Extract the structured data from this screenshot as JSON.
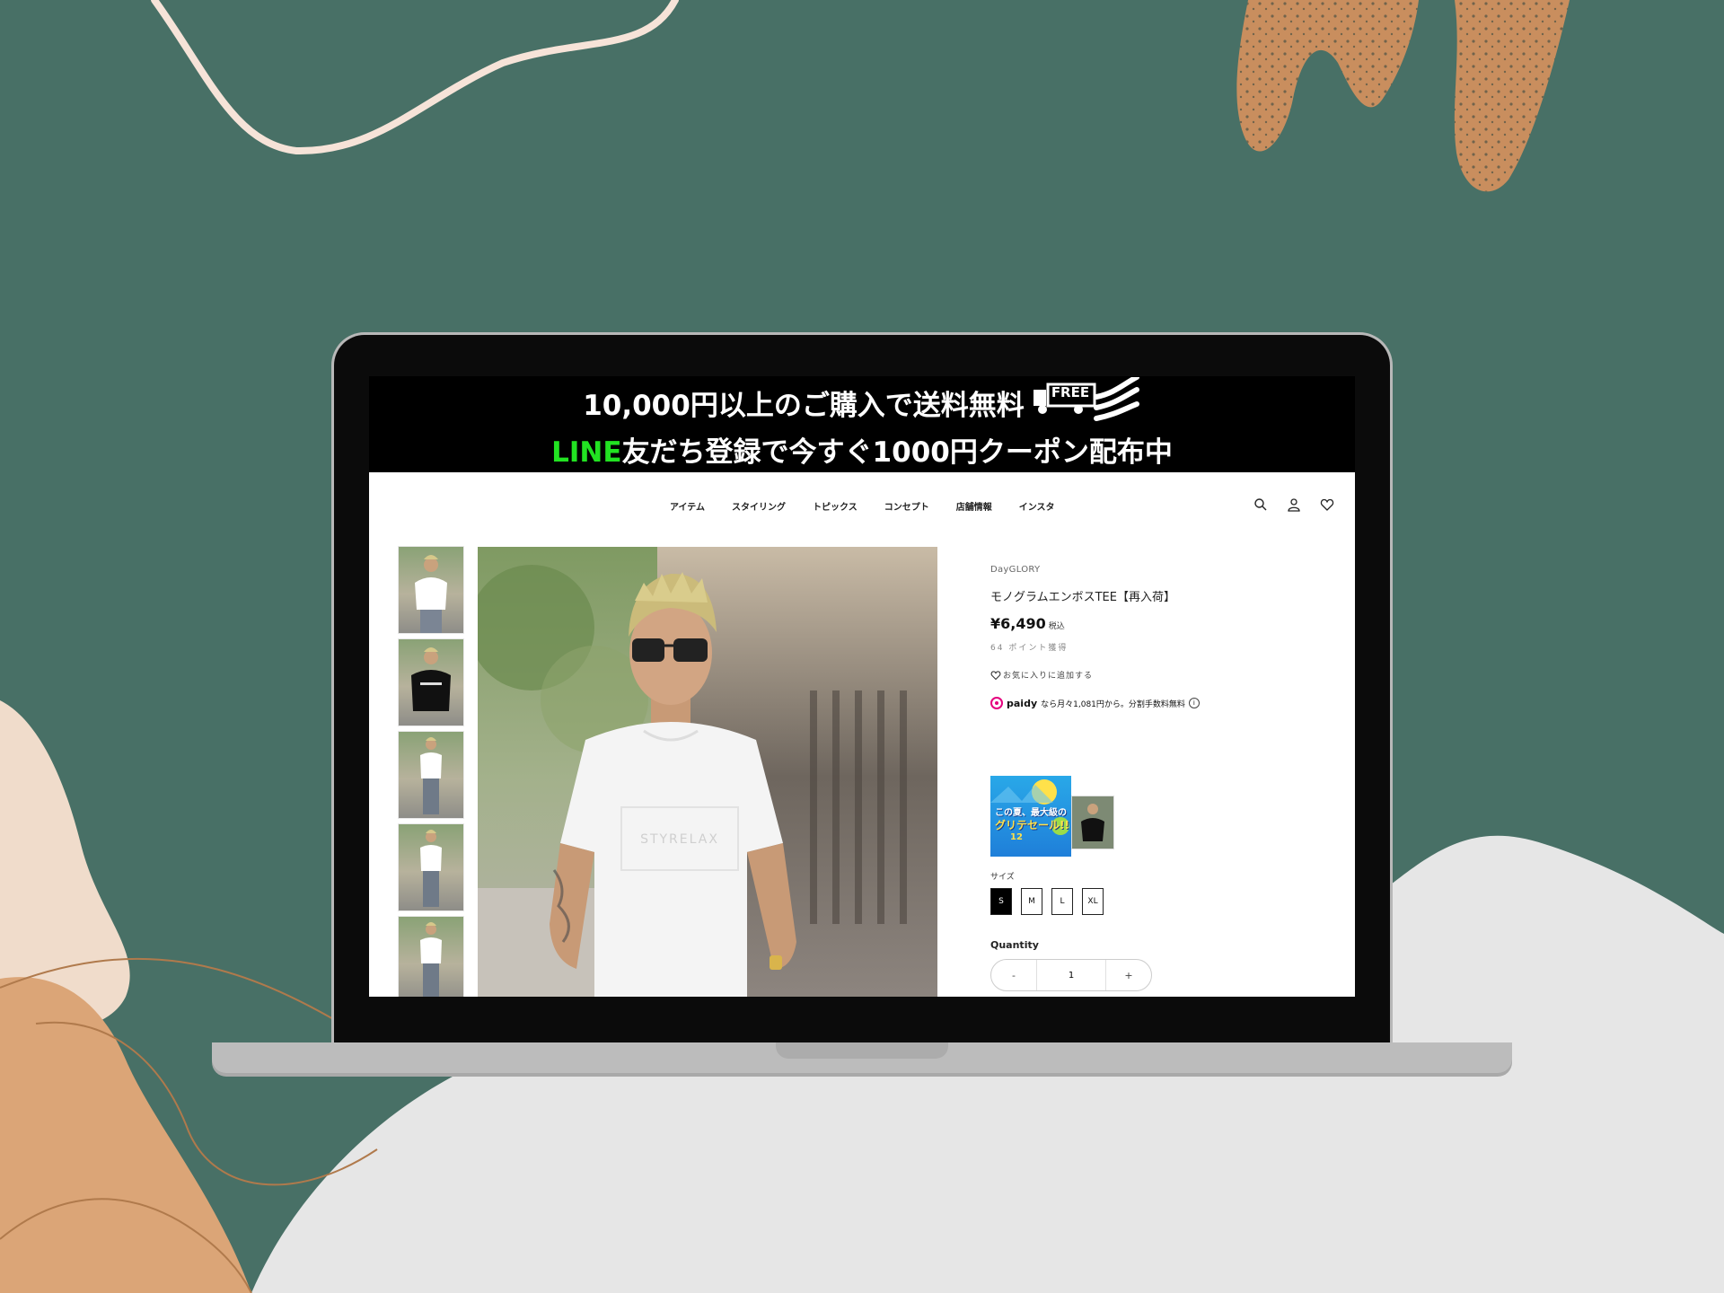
{
  "promo": {
    "line1": "10,000円以上のご購入で送料無料",
    "free_tag": "FREE",
    "line2_green": "LINE",
    "line2_rest": "友だち登録で今すぐ1000円クーポン配布中"
  },
  "nav": {
    "links": [
      "アイテム",
      "スタイリング",
      "トピックス",
      "コンセプト",
      "店舗情報",
      "インスタ"
    ],
    "icons": [
      "search-icon",
      "account-icon",
      "heart-icon"
    ]
  },
  "product": {
    "brand": "DayGLORY",
    "title": "モノグラムエンボスTEE【再入荷】",
    "price": "¥6,490",
    "tax_label": "税込",
    "points": "64 ポイント獲得",
    "favorite_label": "お気に入りに追加する",
    "paidy_logo": "paidy",
    "paidy_text": "なら月々1,081円から。分割手数料無料",
    "info_icon": "i",
    "tshirt_print": "STYRELAX",
    "thumbnail_count": 5
  },
  "banner": {
    "line1": "この夏、最大級の",
    "line2": "グリテセール!!",
    "line3": "12"
  },
  "sizes": {
    "label": "サイズ",
    "options": [
      "S",
      "M",
      "L",
      "XL"
    ],
    "selected": "S"
  },
  "quantity": {
    "label": "Quantity",
    "minus": "-",
    "plus": "+",
    "value": "1"
  },
  "colors": {
    "background": "#487066",
    "accent_green": "#22e322"
  }
}
